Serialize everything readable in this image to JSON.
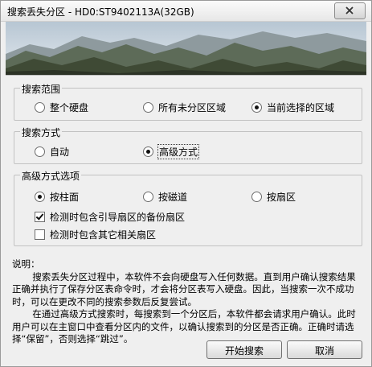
{
  "window": {
    "title": "搜索丢失分区 - HD0:ST9402113A(32GB)"
  },
  "icons": {
    "close": "close-icon",
    "banner": "mountain-landscape-banner"
  },
  "search_range": {
    "title": "搜索范围",
    "options": [
      {
        "label": "整个硬盘",
        "selected": false
      },
      {
        "label": "所有未分区区域",
        "selected": false
      },
      {
        "label": "当前选择的区域",
        "selected": true
      }
    ]
  },
  "search_mode": {
    "title": "搜索方式",
    "options": [
      {
        "label": "自动",
        "selected": false
      },
      {
        "label": "高级方式",
        "selected": true
      }
    ]
  },
  "advanced": {
    "title": "高级方式选项",
    "options": [
      {
        "label": "按柱面",
        "selected": true
      },
      {
        "label": "按磁道",
        "selected": false
      },
      {
        "label": "按扇区",
        "selected": false
      }
    ],
    "checks": [
      {
        "label": "检测时包含引导扇区的备份扇区",
        "checked": true
      },
      {
        "label": "检测时包含其它相关扇区",
        "checked": false
      }
    ]
  },
  "note": {
    "heading": "说明：",
    "para1": "搜索丢失分区过程中，本软件不会向硬盘写入任何数据。直到用户确认搜索结果正确并执行了保存分区表命令时，才会将分区表写入硬盘。因此，当搜索一次不成功时，可以在更改不同的搜索参数后反复尝试。",
    "para2": "在通过高级方式搜索时，每搜索到一个分区后，本软件都会请求用户确认。此时用户可以在主窗口中查看分区内的文件，以确认搜索到的分区是否正确。正确时请选择“保留”，否则选择“跳过”。"
  },
  "buttons": {
    "start": "开始搜索",
    "cancel": "取消"
  }
}
